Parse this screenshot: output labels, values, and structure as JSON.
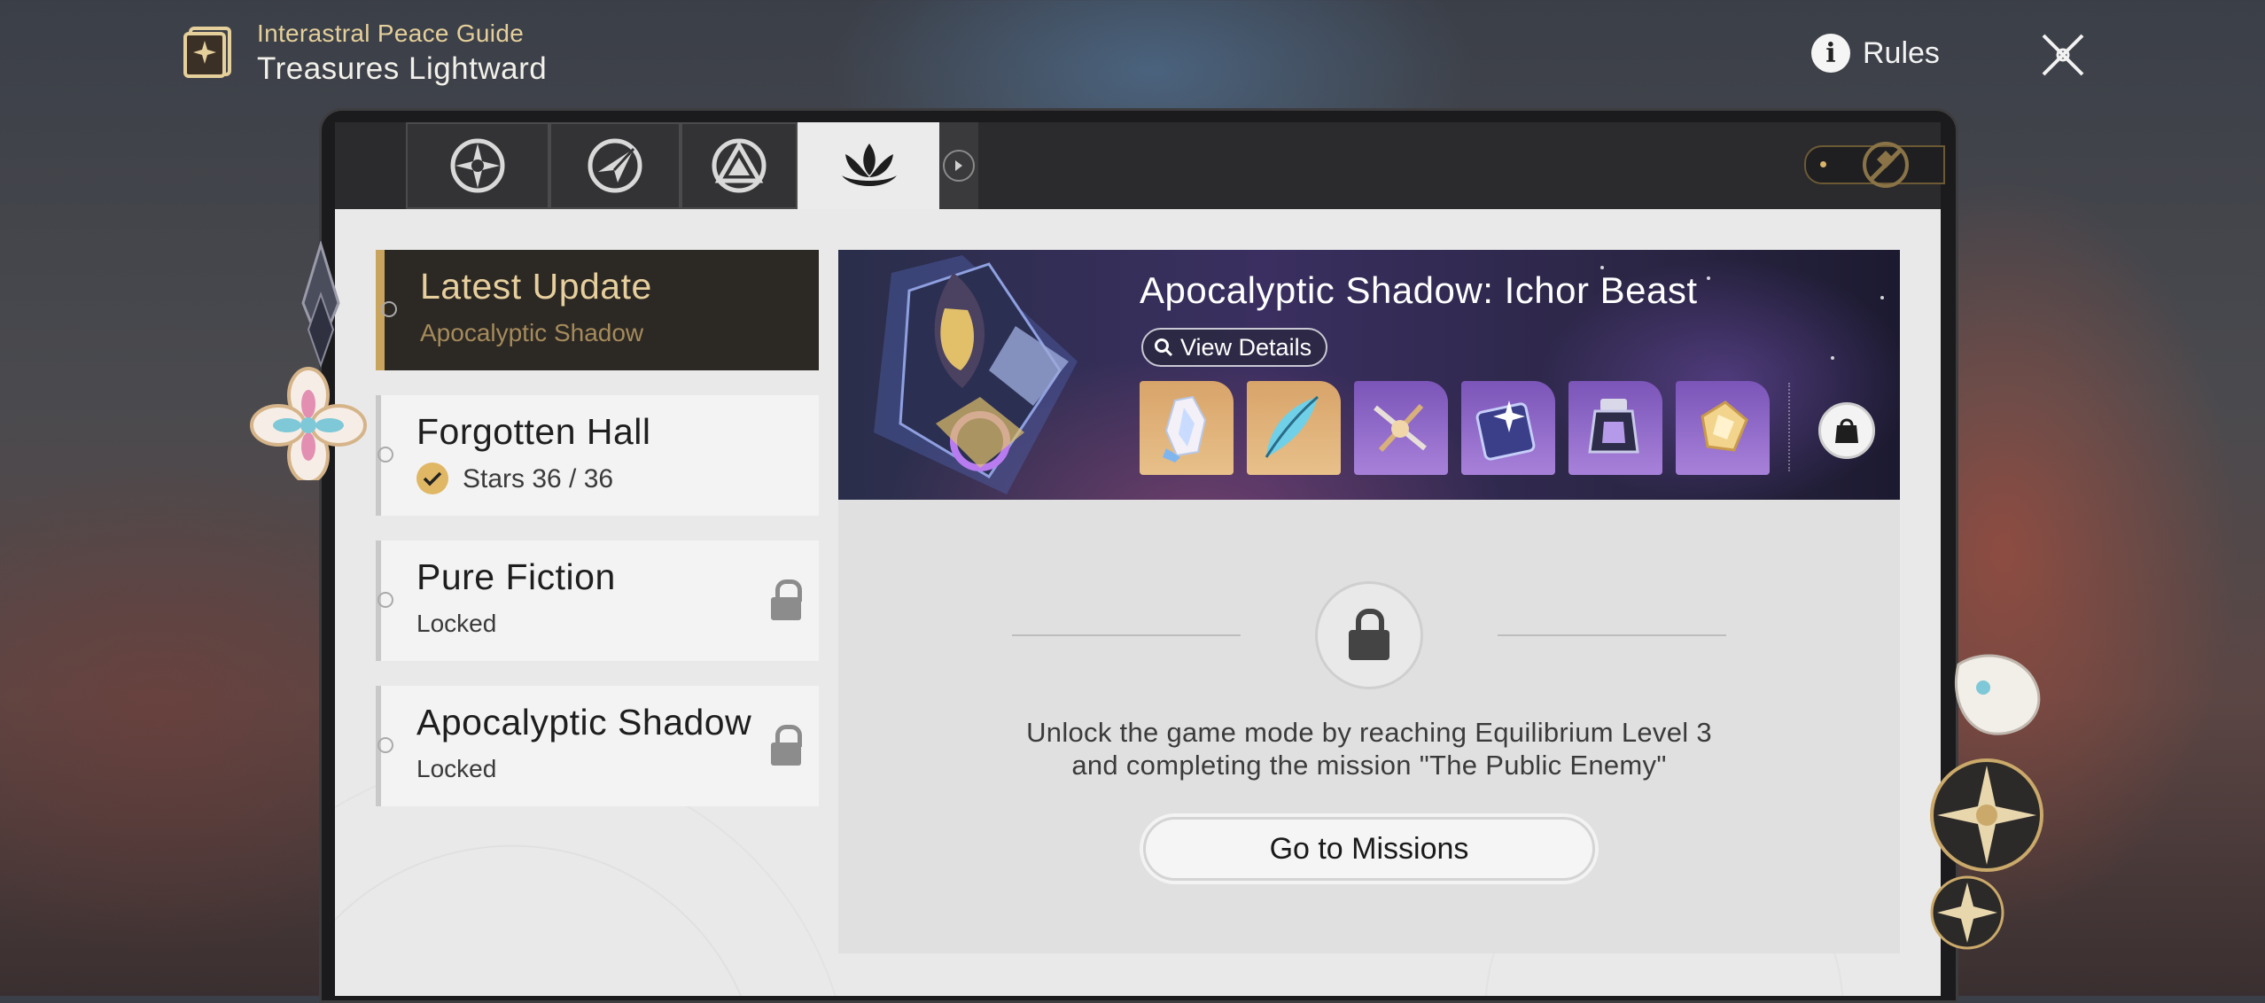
{
  "header": {
    "subtitle": "Interastral Peace Guide",
    "title": "Treasures Lightward",
    "rules_label": "Rules",
    "rules_icon": "info-icon",
    "close_icon": "close-icon"
  },
  "tabs": [
    {
      "icon": "star-emblem-icon",
      "active": false
    },
    {
      "icon": "compass-arrow-icon",
      "active": false
    },
    {
      "icon": "triangle-emblem-icon",
      "active": false
    },
    {
      "icon": "lotus-emblem-icon",
      "active": true
    }
  ],
  "modes": [
    {
      "title": "Latest Update",
      "subtitle": "Apocalyptic Shadow",
      "selected": true
    },
    {
      "title": "Forgotten Hall",
      "stars_text": "Stars 36 / 36",
      "completed": true
    },
    {
      "title": "Pure Fiction",
      "subtitle": "Locked",
      "locked": true
    },
    {
      "title": "Apocalyptic Shadow",
      "subtitle": "Locked",
      "locked": true
    }
  ],
  "banner": {
    "title": "Apocalyptic Shadow: Ichor Beast",
    "view_details_label": "View Details",
    "rewards": [
      {
        "icon": "crystal-icon",
        "rarity": "gold"
      },
      {
        "icon": "feather-icon",
        "rarity": "gold"
      },
      {
        "icon": "crossed-keys-icon",
        "rarity": "purple"
      },
      {
        "icon": "star-book-icon",
        "rarity": "purple"
      },
      {
        "icon": "potion-icon",
        "rarity": "purple"
      },
      {
        "icon": "gem-icon",
        "rarity": "purple"
      }
    ],
    "shop_icon": "bag-icon"
  },
  "locked_panel": {
    "message_line1": "Unlock the game mode by reaching Equilibrium Level 3",
    "message_line2": "and completing the mission \"The Public Enemy\"",
    "button_label": "Go to Missions"
  },
  "colors": {
    "accent_gold": "#c8a45e",
    "panel_bg": "#e9e9e9",
    "dark_frame": "#1b1b1d"
  }
}
